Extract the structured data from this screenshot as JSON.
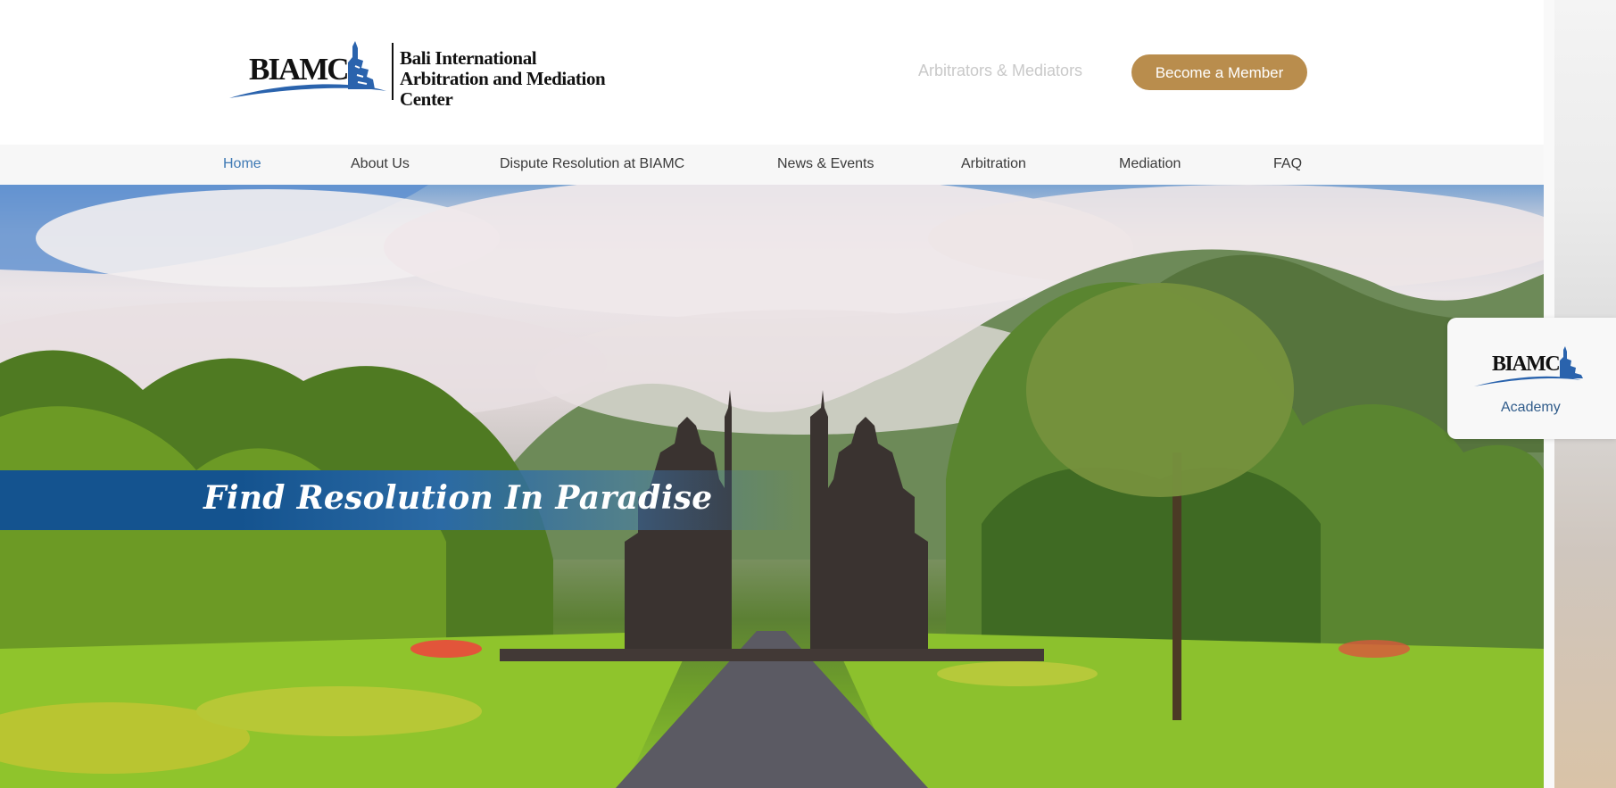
{
  "header": {
    "logo": {
      "acronym": "BIAMC",
      "line1": "Bali International",
      "line2": "Arbitration and Mediation Center"
    },
    "arbitrators_link": "Arbitrators & Mediators",
    "member_button": "Become a Member"
  },
  "nav": {
    "items": [
      {
        "label": "Home",
        "active": true
      },
      {
        "label": "About Us",
        "active": false
      },
      {
        "label": "Dispute Resolution at BIAMC",
        "active": false
      },
      {
        "label": "News & Events",
        "active": false
      },
      {
        "label": "Arbitration",
        "active": false
      },
      {
        "label": "Mediation",
        "active": false
      },
      {
        "label": "FAQ",
        "active": false
      }
    ]
  },
  "hero": {
    "headline": "Find Resolution In Paradise",
    "image_description": "Balinese split temple gate on a path through green gardens with misty mountains"
  },
  "academy_card": {
    "acronym": "BIAMC",
    "label": "Academy"
  },
  "colors": {
    "brand_gold": "#b98d4d",
    "brand_blue": "#14538f",
    "nav_active": "#3e79b4",
    "link_muted": "#c9c9c9"
  },
  "icons": [
    "biamc-logo-icon",
    "temple-gate-icon"
  ]
}
